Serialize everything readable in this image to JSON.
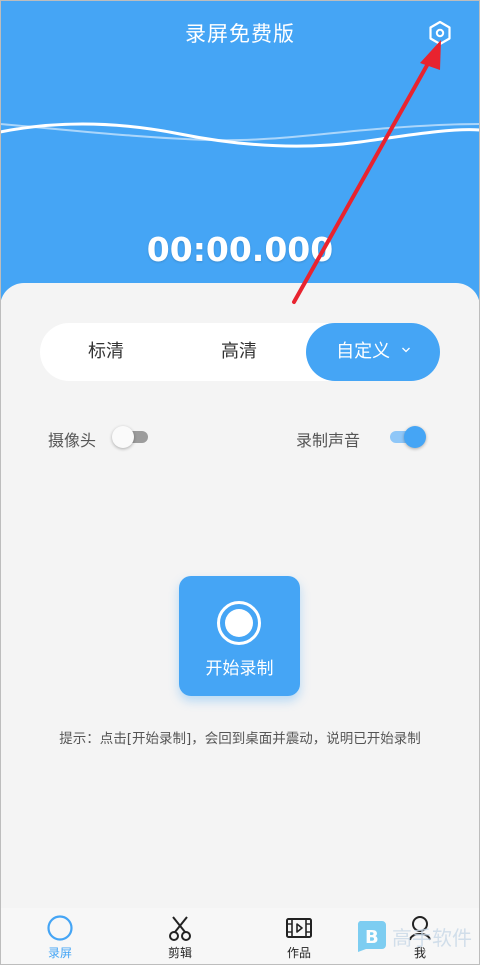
{
  "header": {
    "title": "录屏免费版",
    "timer": "00:00.000",
    "settings_icon": "settings-hexagon-icon"
  },
  "quality": {
    "options": [
      "标清",
      "高清",
      "自定义"
    ],
    "selected": "自定义"
  },
  "toggles": {
    "camera": {
      "label": "摄像头",
      "on": false
    },
    "audio": {
      "label": "录制声音",
      "on": true
    }
  },
  "record": {
    "label": "开始录制"
  },
  "hint": "提示：点击[开始录制]，会回到桌面并震动，说明已开始录制",
  "tabs": [
    {
      "label": "录屏",
      "icon": "circle-icon",
      "active": true
    },
    {
      "label": "剪辑",
      "icon": "scissors-icon",
      "active": false
    },
    {
      "label": "作品",
      "icon": "film-icon",
      "active": false
    },
    {
      "label": "我",
      "icon": "person-icon",
      "active": false
    }
  ],
  "watermark": {
    "text": "高手软件"
  },
  "colors": {
    "primary": "#45a5f5",
    "background": "#f4f4f4",
    "annotation_arrow": "#e8232f"
  }
}
